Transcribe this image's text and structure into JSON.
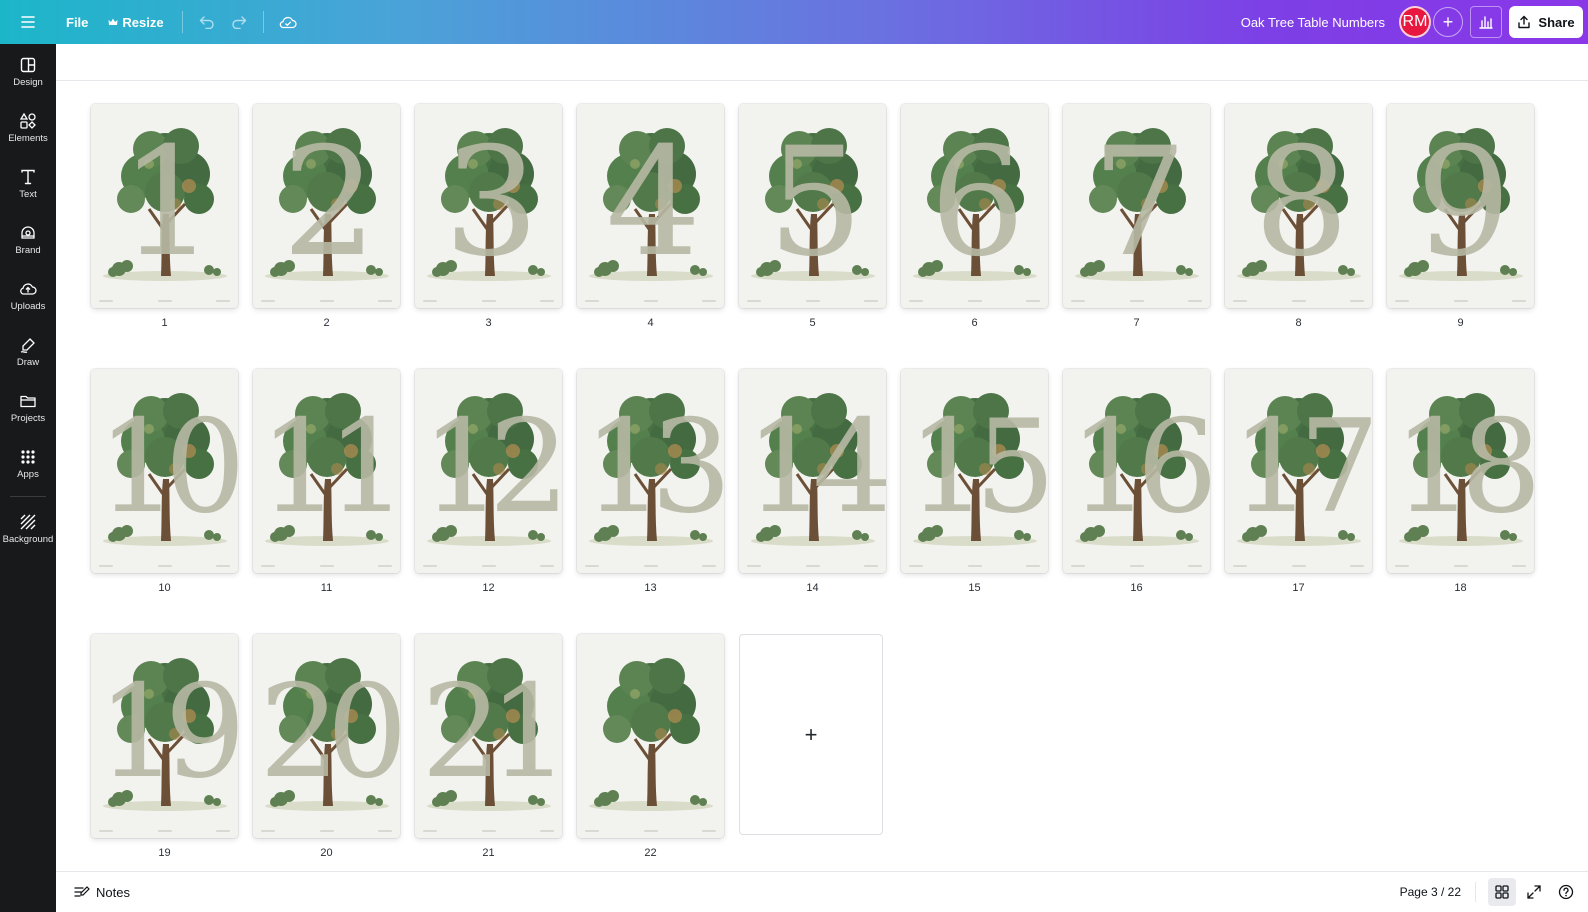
{
  "topbar": {
    "menu_icon": "hamburger-icon",
    "file_label": "File",
    "resize_label": "Resize",
    "undo_icon": "undo-icon",
    "redo_icon": "redo-icon",
    "save_status_icon": "cloud-check-icon",
    "doc_title": "Oak Tree Table Numbers",
    "avatar_initials": "RM",
    "avatar_color": "#e8173f",
    "add_collaborator_icon": "plus-icon",
    "insights_icon": "bar-chart-icon",
    "share_label": "Share",
    "share_icon": "share-upload-icon"
  },
  "sidebar": {
    "items": [
      {
        "label": "Design",
        "icon": "design-icon"
      },
      {
        "label": "Elements",
        "icon": "elements-icon"
      },
      {
        "label": "Text",
        "icon": "text-icon"
      },
      {
        "label": "Brand",
        "icon": "brand-icon"
      },
      {
        "label": "Uploads",
        "icon": "upload-cloud-icon"
      },
      {
        "label": "Draw",
        "icon": "draw-pen-icon"
      },
      {
        "label": "Projects",
        "icon": "folder-icon"
      },
      {
        "label": "Apps",
        "icon": "apps-grid-icon"
      },
      {
        "label": "Background",
        "icon": "background-hatch-icon"
      }
    ]
  },
  "pages": [
    {
      "label": "1",
      "number": "1"
    },
    {
      "label": "2",
      "number": "2"
    },
    {
      "label": "3",
      "number": "3"
    },
    {
      "label": "4",
      "number": "4"
    },
    {
      "label": "5",
      "number": "5"
    },
    {
      "label": "6",
      "number": "6"
    },
    {
      "label": "7",
      "number": "7"
    },
    {
      "label": "8",
      "number": "8"
    },
    {
      "label": "9",
      "number": "9"
    },
    {
      "label": "10",
      "number": "10"
    },
    {
      "label": "11",
      "number": "11"
    },
    {
      "label": "12",
      "number": "12"
    },
    {
      "label": "13",
      "number": "13"
    },
    {
      "label": "14",
      "number": "14"
    },
    {
      "label": "15",
      "number": "15"
    },
    {
      "label": "16",
      "number": "16"
    },
    {
      "label": "17",
      "number": "17"
    },
    {
      "label": "18",
      "number": "18"
    },
    {
      "label": "19",
      "number": "19"
    },
    {
      "label": "20",
      "number": "20"
    },
    {
      "label": "21",
      "number": "21"
    },
    {
      "label": "22",
      "number": ""
    }
  ],
  "add_page": {
    "icon": "plus-icon",
    "symbol": "+"
  },
  "bottombar": {
    "notes_label": "Notes",
    "notes_icon": "notes-icon",
    "page_indicator": "Page 3 / 22",
    "grid_view_icon": "grid-view-icon",
    "fullscreen_icon": "fullscreen-icon",
    "help_icon": "help-icon"
  },
  "colors": {
    "accent_gradient_start": "#1cb6c9",
    "accent_gradient_end": "#8a37e8",
    "sidebar_bg": "#18191b",
    "numeral": "#b7b9a4",
    "tree_foliage": "#3f6a3c"
  }
}
